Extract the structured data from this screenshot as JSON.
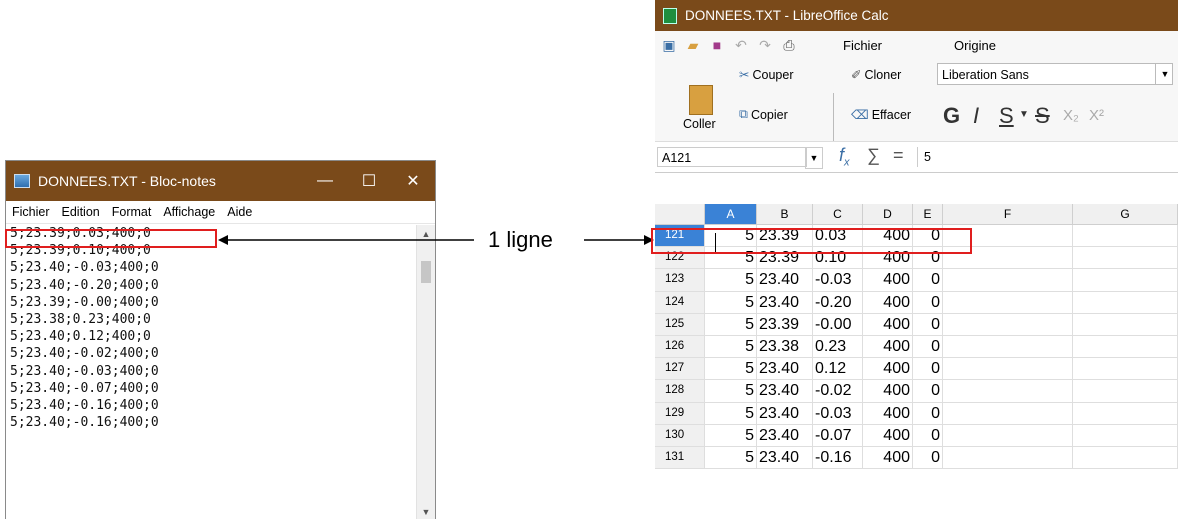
{
  "notepad": {
    "title": "DONNEES.TXT - Bloc-notes",
    "controls": {
      "minimize": "—",
      "maximize": "☐",
      "close": "✕"
    },
    "menu": [
      "Fichier",
      "Edition",
      "Format",
      "Affichage",
      "Aide"
    ],
    "lines": [
      "5;23.39;0.03;400;0",
      "5;23.39;0.10;400;0",
      "5;23.40;-0.03;400;0",
      "5;23.40;-0.20;400;0",
      "5;23.39;-0.00;400;0",
      "5;23.38;0.23;400;0",
      "5;23.40;0.12;400;0",
      "5;23.40;-0.02;400;0",
      "5;23.40;-0.03;400;0",
      "5;23.40;-0.07;400;0",
      "5;23.40;-0.16;400;0",
      "5;23.40;-0.16;400;0"
    ]
  },
  "annotation": {
    "label": "1 ligne",
    "highlight_color": "#e01e1e"
  },
  "calc": {
    "title": "DONNEES.TXT - LibreOffice Calc",
    "tabs": {
      "file": "Fichier",
      "home": "Origine"
    },
    "ribbon": {
      "cut": "Couper",
      "copy": "Copier",
      "paste": "Coller",
      "clone": "Cloner",
      "clear": "Effacer",
      "font": "Liberation Sans",
      "bold": "G",
      "italic": "I",
      "underline": "S",
      "strike": "S",
      "subscript": "X₂",
      "superscript": "X²"
    },
    "namebox": "A121",
    "formula": "5",
    "columns": [
      "A",
      "B",
      "C",
      "D",
      "E",
      "F",
      "G"
    ],
    "rows": [
      {
        "n": "121",
        "a": "5",
        "b": "23.39",
        "c": "0.03",
        "d": "400",
        "e": "0"
      },
      {
        "n": "122",
        "a": "5",
        "b": "23.39",
        "c": "0.10",
        "d": "400",
        "e": "0"
      },
      {
        "n": "123",
        "a": "5",
        "b": "23.40",
        "c": "-0.03",
        "d": "400",
        "e": "0"
      },
      {
        "n": "124",
        "a": "5",
        "b": "23.40",
        "c": "-0.20",
        "d": "400",
        "e": "0"
      },
      {
        "n": "125",
        "a": "5",
        "b": "23.39",
        "c": "-0.00",
        "d": "400",
        "e": "0"
      },
      {
        "n": "126",
        "a": "5",
        "b": "23.38",
        "c": "0.23",
        "d": "400",
        "e": "0"
      },
      {
        "n": "127",
        "a": "5",
        "b": "23.40",
        "c": "0.12",
        "d": "400",
        "e": "0"
      },
      {
        "n": "128",
        "a": "5",
        "b": "23.40",
        "c": "-0.02",
        "d": "400",
        "e": "0"
      },
      {
        "n": "129",
        "a": "5",
        "b": "23.40",
        "c": "-0.03",
        "d": "400",
        "e": "0"
      },
      {
        "n": "130",
        "a": "5",
        "b": "23.40",
        "c": "-0.07",
        "d": "400",
        "e": "0"
      },
      {
        "n": "131",
        "a": "5",
        "b": "23.40",
        "c": "-0.16",
        "d": "400",
        "e": "0"
      }
    ]
  }
}
